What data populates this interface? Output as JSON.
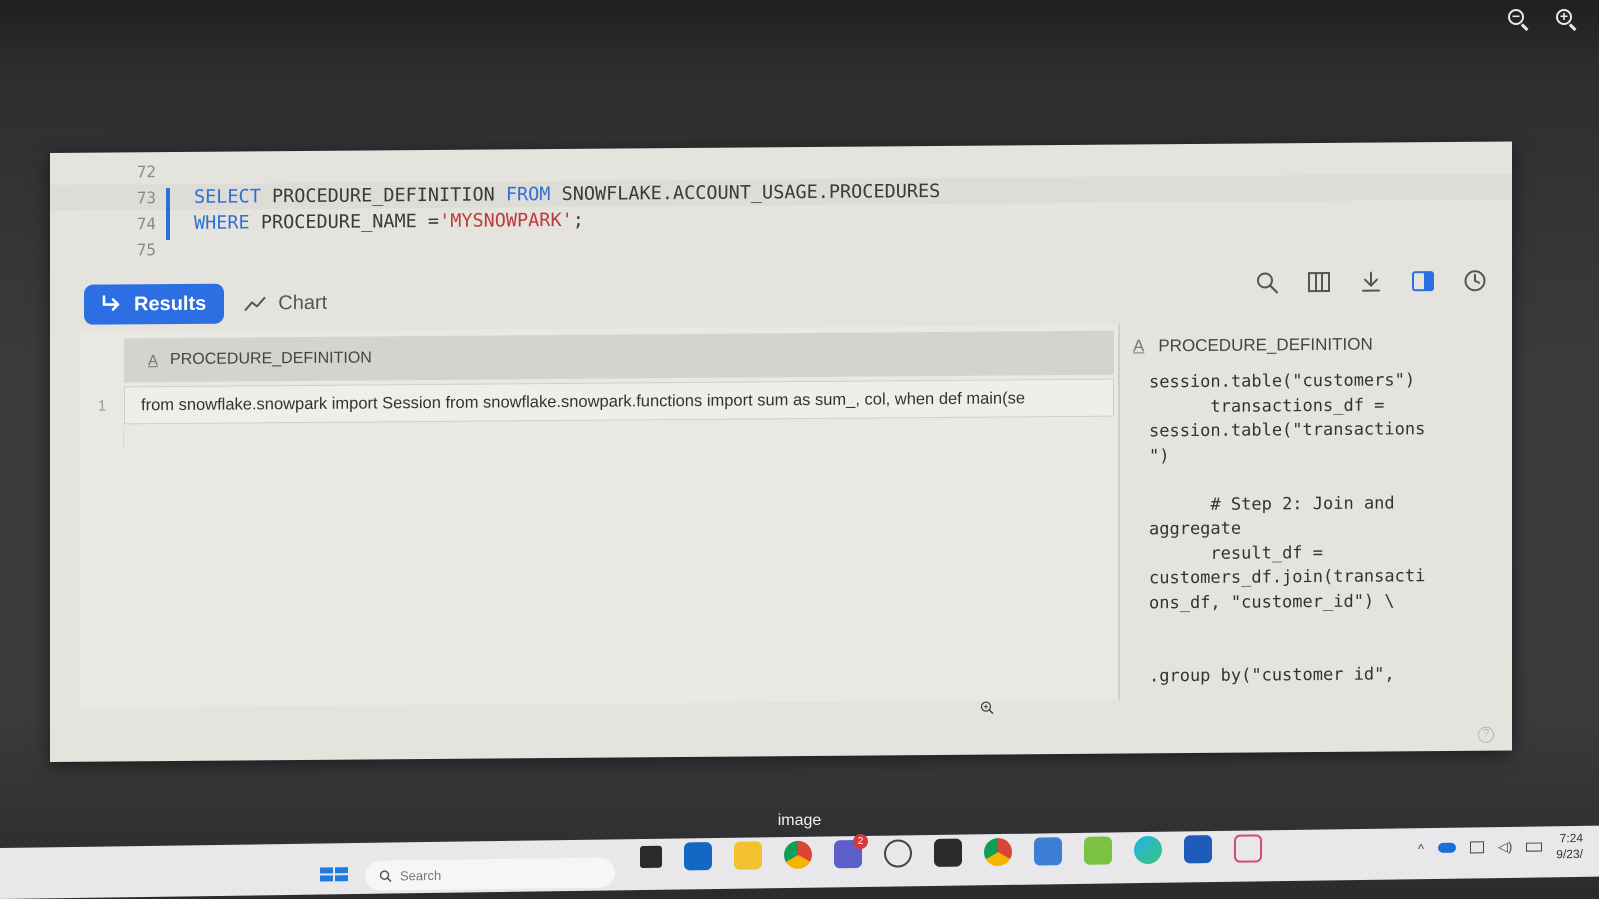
{
  "viewer": {
    "zoom_out_icon": "zoom-out-icon",
    "zoom_in_icon": "zoom-in-icon",
    "caption": "image"
  },
  "editor": {
    "lines": [
      {
        "num": "72"
      },
      {
        "num": "73",
        "segments": [
          {
            "t": "SELECT",
            "kind": "kw"
          },
          {
            "t": " PROCEDURE_DEFINITION ",
            "kind": "plain"
          },
          {
            "t": "FROM",
            "kind": "kw"
          },
          {
            "t": " SNOWFLAKE.ACCOUNT_USAGE.PROCEDURES",
            "kind": "plain"
          }
        ]
      },
      {
        "num": "74",
        "segments": [
          {
            "t": "WHERE",
            "kind": "kw"
          },
          {
            "t": " PROCEDURE_NAME =",
            "kind": "plain"
          },
          {
            "t": "'MYSNOWPARK'",
            "kind": "str"
          },
          {
            "t": ";",
            "kind": "plain"
          }
        ]
      },
      {
        "num": "75"
      }
    ]
  },
  "tabs": {
    "results_label": "Results",
    "chart_label": "Chart"
  },
  "toolbar": {
    "icons": [
      "search-icon",
      "columns-icon",
      "download-icon",
      "split-panel-icon",
      "history-icon"
    ]
  },
  "grid": {
    "column_header": "PROCEDURE_DEFINITION",
    "column_type_glyph": "A",
    "rows": [
      {
        "num": "1",
        "value": "from snowflake.snowpark import Session from snowflake.snowpark.functions import sum as sum_, col, when def main(se"
      }
    ]
  },
  "detail": {
    "title": "PROCEDURE_DEFINITION",
    "type_glyph": "A",
    "code": "session.table(\"customers\")\n      transactions_df =\nsession.table(\"transactions\n\")\n\n      # Step 2: Join and\naggregate\n      result_df =\ncustomers_df.join(transacti\nons_df, \"customer_id\") \\\n\n\n.group by(\"customer id\","
  },
  "help_glyph": "?",
  "taskbar": {
    "search_placeholder": "Search",
    "teams_badge": "2",
    "clock_time": "7:24",
    "clock_date": "9/23/"
  },
  "colors": {
    "accent": "#2b6fe3",
    "keyword": "#2f6fd6",
    "string": "#c0393b"
  }
}
